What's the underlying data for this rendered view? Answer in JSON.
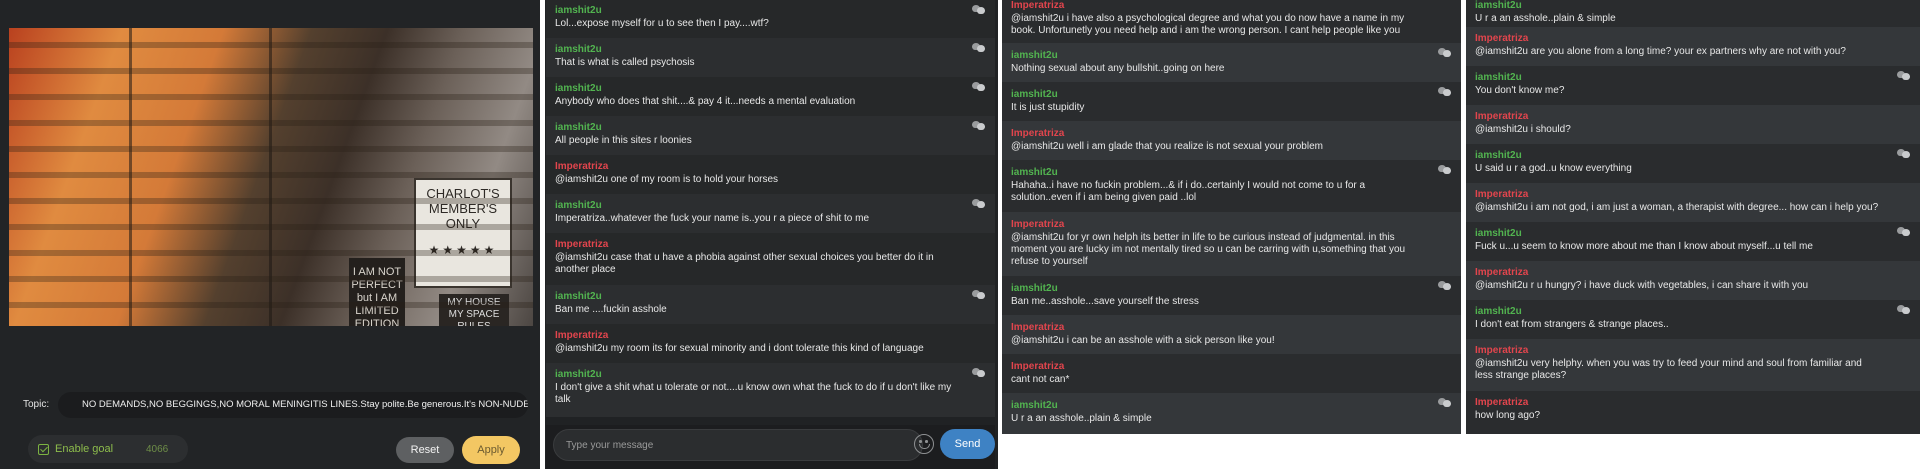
{
  "broadcaster": {
    "video_signs": {
      "charlie": "CHARLOT'S MEMBER'S ONLY",
      "not_perfect": "I AM NOT PERFECT but I AM LIMITED EDITION",
      "my_house": "MY HOUSE MY SPACE RULES"
    },
    "topic_label": "Topic:",
    "topic_text": "NO DEMANDS,NO BEGGINGS,NO MORAL MENINGITIS LINES.Stay polite.Be generous.It's NON-NUDE r",
    "goal_label": "Enable goal",
    "goal_value": "4066",
    "reset_label": "Reset",
    "apply_label": "Apply"
  },
  "chat1": {
    "messages": [
      {
        "user": "iamshit2u",
        "text": "Lol...expose myself for u to see then I pay....wtf?"
      },
      {
        "user": "iamshit2u",
        "text": "That is what is called psychosis"
      },
      {
        "user": "iamshit2u",
        "text": "Anybody who does that shit....& pay 4 it...needs a mental evaluation"
      },
      {
        "user": "iamshit2u",
        "text": "All people in this sites r loonies"
      },
      {
        "user": "Imperatriza",
        "text": "@iamshit2u one of my room is to hold your horses"
      },
      {
        "user": "iamshit2u",
        "text": "Imperatriza..whatever the fuck your name is..you r a piece of shit to me"
      },
      {
        "user": "Imperatriza",
        "text": "@iamshit2u case that u have a phobia against other sexual choices you better do it in another place"
      },
      {
        "user": "iamshit2u",
        "text": "Ban me ....fuckin asshole"
      },
      {
        "user": "Imperatriza",
        "text": "@iamshit2u my room its for sexual minority and i dont tolerate this kind of language"
      },
      {
        "user": "iamshit2u",
        "text": "I don't give a shit what u tolerate or not....u know own what the fuck to do if u don't like my talk"
      }
    ],
    "input_placeholder": "Type your message",
    "send_label": "Send"
  },
  "chat2": {
    "messages": [
      {
        "user": "Imperatriza",
        "text": "@iamshit2u i have also a psychological degree and what you do now have a name in my book. Unfortunetly you need help and i am the wrong person. I cant help people like you"
      },
      {
        "user": "iamshit2u",
        "text": "Nothing sexual about any bullshit..going on here"
      },
      {
        "user": "iamshit2u",
        "text": "It is just stupidity"
      },
      {
        "user": "Imperatriza",
        "text": "@iamshit2u well i am glade that you realize is not sexual your problem"
      },
      {
        "user": "iamshit2u",
        "text": "Hahaha..i have no fuckin problem...& if i do..certainly I would not come to u for a solution..even if i am being given paid ..lol"
      },
      {
        "user": "Imperatriza",
        "text": "@iamshit2u for yr own helph its better in life to be curious instead of judgmental. in this moment you are lucky im not mentally tired so u can be carring with u,something that you refuse to yourself"
      },
      {
        "user": "iamshit2u",
        "text": "Ban me..asshole...save yourself the stress"
      },
      {
        "user": "Imperatriza",
        "text": "@iamshit2u i can be an asshole with a sick person like you!"
      },
      {
        "user": "Imperatriza",
        "text": "cant not can*"
      },
      {
        "user": "iamshit2u",
        "text": "U r a an asshole..plain & simple"
      }
    ]
  },
  "chat3": {
    "messages": [
      {
        "user": "iamshit2u",
        "text": "U r a an asshole..plain & simple"
      },
      {
        "user": "Imperatriza",
        "text": "@iamshit2u are you alone from a long time? your ex partners why are not with you?"
      },
      {
        "user": "iamshit2u",
        "text": "You don't know me?"
      },
      {
        "user": "Imperatriza",
        "text": "@iamshit2u i should?"
      },
      {
        "user": "iamshit2u",
        "text": "U said u r a god..u know everything"
      },
      {
        "user": "Imperatriza",
        "text": "@iamshit2u i am not god, i am just a woman, a therapist with degree... how can i help you?"
      },
      {
        "user": "iamshit2u",
        "text": "Fuck u...u seem to know more about me than I know about myself...u tell me"
      },
      {
        "user": "Imperatriza",
        "text": "@iamshit2u r u hungry? i have duck with vegetables, i can share it with you"
      },
      {
        "user": "iamshit2u",
        "text": "I don't eat from strangers & strange places.."
      },
      {
        "user": "Imperatriza",
        "text": "@iamshit2u very helphy. when you was try to feed your mind and soul from familiar and less strange places?"
      },
      {
        "user": "Imperatriza",
        "text": "how long ago?"
      }
    ]
  },
  "colors": {
    "username_green": "#52b450",
    "username_red": "#e2454d",
    "send_button": "#3e82c4",
    "apply_button": "#f3c763",
    "reset_button": "#5e6062"
  }
}
